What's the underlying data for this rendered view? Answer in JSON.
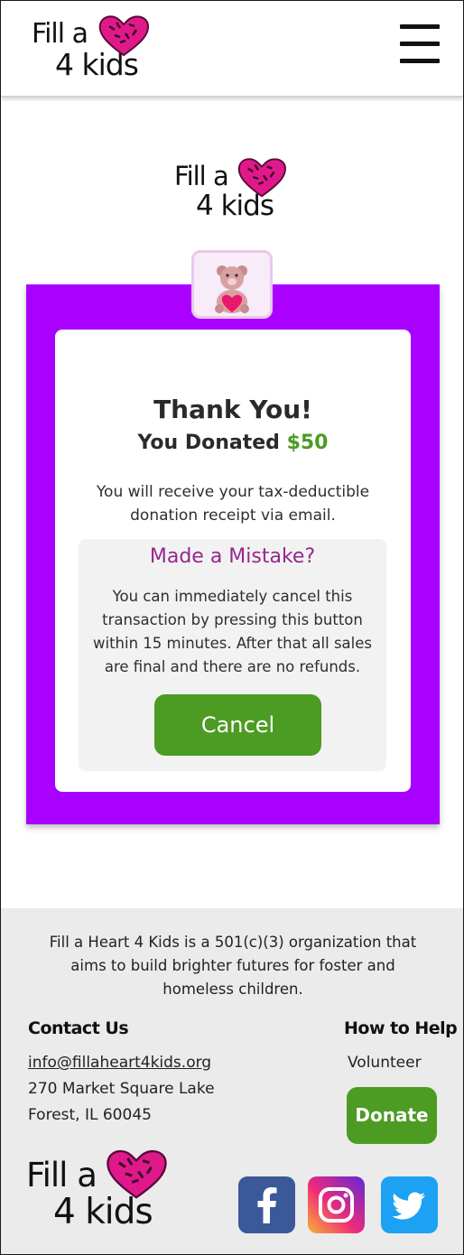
{
  "header": {
    "logo_line1": "Fill a",
    "logo_line2": "4 kids",
    "menu_icon": "hamburger-menu-icon"
  },
  "hero_logo": {
    "line1": "Fill a",
    "line2": "4 kids"
  },
  "badge_icon": "teddy-bear-heart-icon",
  "confirmation": {
    "title": "Thank You!",
    "subtitle_prefix": "You Donated ",
    "amount": "$50",
    "note_line1": "You will receive your tax-deductible",
    "note_line2": "donation receipt via email."
  },
  "mistake": {
    "title": "Made a Mistake?",
    "line1": "You can immediately cancel this",
    "line2": "transaction by pressing this button",
    "line3": "within 15 minutes. After that all sales",
    "line4": "are final and there are no refunds.",
    "cancel_label": "Cancel"
  },
  "footer": {
    "about_line1": "Fill a Heart 4 Kids is a 501(c)(3) organization that",
    "about_line2": "aims to build brighter futures for foster and",
    "about_line3": "homeless children.",
    "contact_heading": "Contact Us",
    "email": "info@fillaheart4kids.org",
    "address_line1": "270 Market Square Lake",
    "address_line2": "Forest, IL 60045",
    "help_heading": "How to Help",
    "volunteer_label": "Volunteer",
    "donate_label": "Donate",
    "logo_line1": "Fill a",
    "logo_line2": "4 kids",
    "social": [
      "facebook-icon",
      "instagram-icon",
      "twitter-icon"
    ]
  },
  "colors": {
    "purple": "#aa00ff",
    "green": "#4c9b22",
    "mistake_title": "#96278f",
    "heart_pink": "#e0198a",
    "facebook": "#3b5998",
    "twitter": "#1da1f2"
  }
}
